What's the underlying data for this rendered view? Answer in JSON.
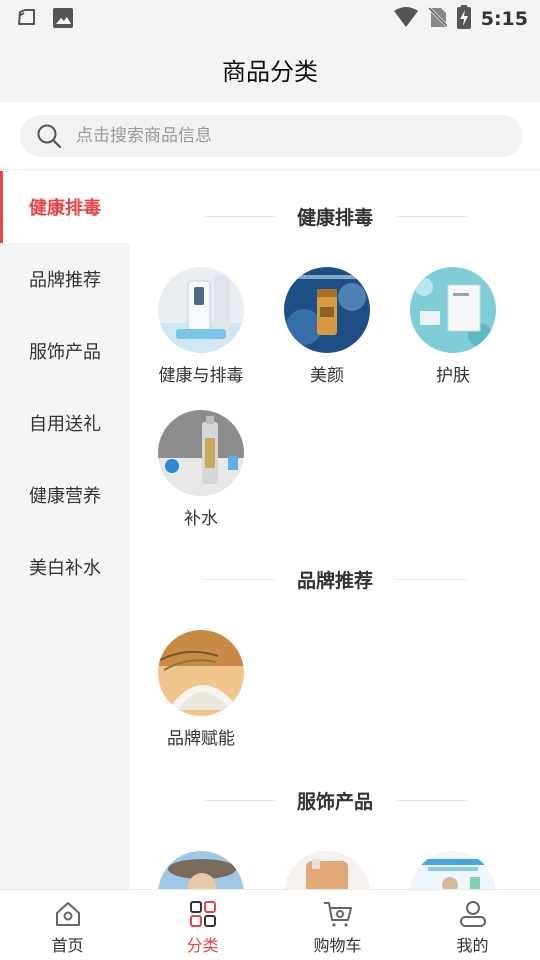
{
  "status_bar": {
    "time": "5:15"
  },
  "header": {
    "title": "商品分类"
  },
  "search": {
    "placeholder": "点击搜索商品信息"
  },
  "sidebar": {
    "items": [
      {
        "label": "健康排毒"
      },
      {
        "label": "品牌推荐"
      },
      {
        "label": "服饰产品"
      },
      {
        "label": "自用送礼"
      },
      {
        "label": "健康营养"
      },
      {
        "label": "美白补水"
      }
    ],
    "active_index": 0
  },
  "sections": [
    {
      "title": "健康排毒",
      "items": [
        {
          "label": "健康与排毒"
        },
        {
          "label": "美颜"
        },
        {
          "label": "护肤"
        },
        {
          "label": "补水"
        }
      ]
    },
    {
      "title": "品牌推荐",
      "items": [
        {
          "label": "品牌赋能"
        }
      ]
    },
    {
      "title": "服饰产品",
      "items": []
    }
  ],
  "tabbar": {
    "items": [
      {
        "label": "首页",
        "icon": "home-icon"
      },
      {
        "label": "分类",
        "icon": "category-icon"
      },
      {
        "label": "购物车",
        "icon": "cart-icon"
      },
      {
        "label": "我的",
        "icon": "user-icon"
      }
    ],
    "active_index": 1
  },
  "colors": {
    "accent": "#e84545",
    "sidebar_bg": "#f5f5f5",
    "header_bg": "#f4f4f4"
  }
}
